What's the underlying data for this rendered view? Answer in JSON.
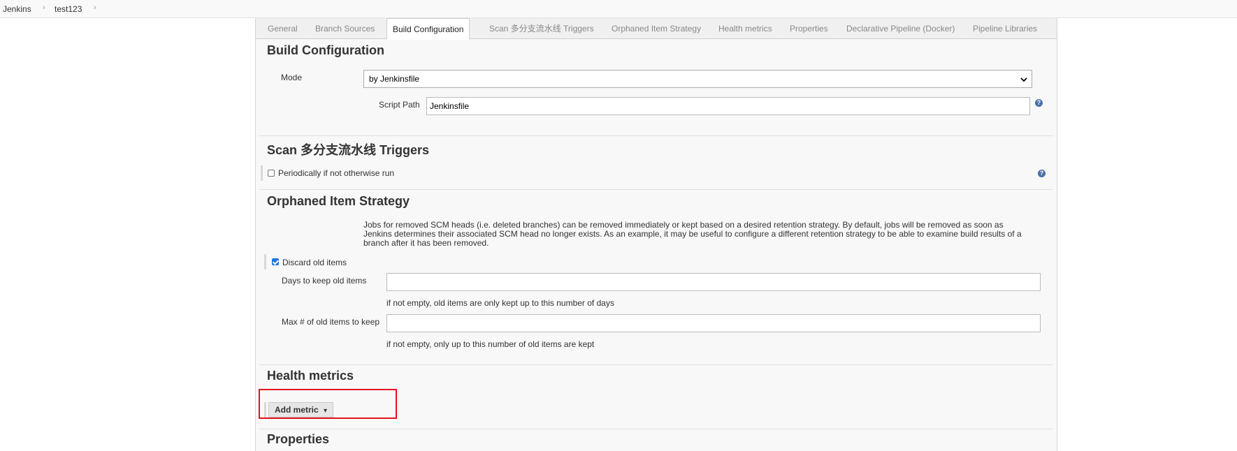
{
  "breadcrumb": {
    "items": [
      "Jenkins",
      "test123"
    ],
    "separator": "›"
  },
  "tabs": [
    {
      "label": "General",
      "active": false
    },
    {
      "label": "Branch Sources",
      "active": false
    },
    {
      "label": "Build Configuration",
      "active": true
    },
    {
      "label": "Scan 多分支流水线 Triggers",
      "active": false
    },
    {
      "label": "Orphaned Item Strategy",
      "active": false
    },
    {
      "label": "Health metrics",
      "active": false
    },
    {
      "label": "Properties",
      "active": false
    },
    {
      "label": "Declarative Pipeline (Docker)",
      "active": false
    },
    {
      "label": "Pipeline Libraries",
      "active": false
    }
  ],
  "build_configuration": {
    "title": "Build Configuration",
    "mode_label": "Mode",
    "mode_value": "by Jenkinsfile",
    "script_path_label": "Script Path",
    "script_path_value": "Jenkinsfile"
  },
  "scan_triggers": {
    "title": "Scan 多分支流水线 Triggers",
    "periodically_label": "Periodically if not otherwise run",
    "periodically_checked": false
  },
  "orphaned": {
    "title": "Orphaned Item Strategy",
    "description_line1": "Jobs for removed SCM heads (i.e. deleted branches) can be removed immediately or kept based on a desired retention strategy. By default, jobs will be removed as soon as",
    "description_line2": "Jenkins determines their associated SCM head no longer exists. As an example, it may be useful to configure a different retention strategy to be able to examine build results of a",
    "description_line3": "branch after it has been removed.",
    "discard_label": "Discard old items",
    "discard_checked": true,
    "days_label": "Days to keep old items",
    "days_value": "",
    "days_hint": "if not empty, old items are only kept up to this number of days",
    "max_label": "Max # of old items to keep",
    "max_value": "",
    "max_hint": "if not empty, only up to this number of old items are kept"
  },
  "health_metrics": {
    "title": "Health metrics",
    "add_metric_label": "Add metric"
  },
  "properties": {
    "title": "Properties"
  },
  "icons": {
    "help": "?",
    "dropdown_caret": "▾"
  },
  "colors": {
    "highlight": "#e3141b",
    "help_icon": "#4a6fa5",
    "checkbox_checked": "#1f73d8"
  }
}
